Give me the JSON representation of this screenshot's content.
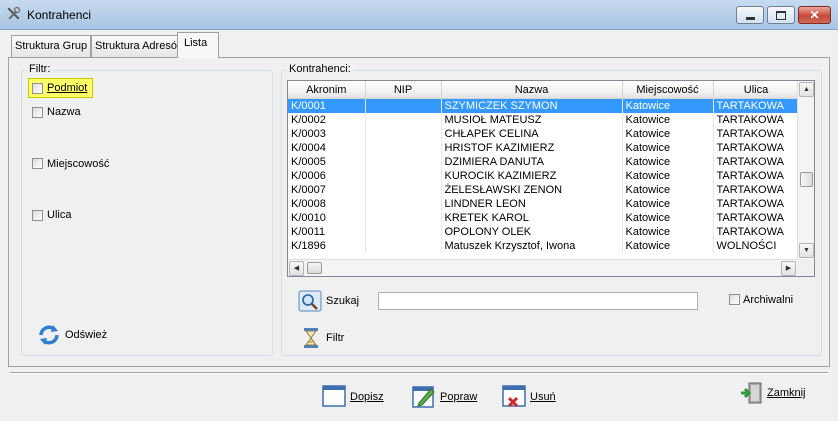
{
  "window": {
    "title": "Kontrahenci"
  },
  "tabs": [
    {
      "label": "Struktura Grup"
    },
    {
      "label": "Struktura Adresów"
    },
    {
      "label": "Lista"
    }
  ],
  "filter": {
    "label": "Filtr:",
    "options": [
      {
        "label": "Podmiot",
        "checked": false,
        "highlighted": true
      },
      {
        "label": "Nazwa",
        "checked": false
      },
      {
        "label": "Miejscowość",
        "checked": false
      },
      {
        "label": "Ulica",
        "checked": false
      }
    ],
    "refresh_label": "Odśwież"
  },
  "contractors": {
    "label": "Kontrahenci:",
    "columns": [
      "Akronim",
      "NIP",
      "Nazwa",
      "Miejscowość",
      "Ulica"
    ],
    "rows": [
      {
        "akronim": "K/0001",
        "nip": "",
        "nazwa": "SZYMICZEK SZYMON",
        "miejscowosc": "Katowice",
        "ulica": "TARTAKOWA",
        "selected": true
      },
      {
        "akronim": "K/0002",
        "nip": "",
        "nazwa": "MUSIOŁ MATEUSZ",
        "miejscowosc": "Katowice",
        "ulica": "TARTAKOWA"
      },
      {
        "akronim": "K/0003",
        "nip": "",
        "nazwa": "CHŁAPEK CELINA",
        "miejscowosc": "Katowice",
        "ulica": "TARTAKOWA"
      },
      {
        "akronim": "K/0004",
        "nip": "",
        "nazwa": "HRISTOF KAZIMIERZ",
        "miejscowosc": "Katowice",
        "ulica": "TARTAKOWA"
      },
      {
        "akronim": "K/0005",
        "nip": "",
        "nazwa": "DZIMIERA DANUTA",
        "miejscowosc": "Katowice",
        "ulica": "TARTAKOWA"
      },
      {
        "akronim": "K/0006",
        "nip": "",
        "nazwa": "KUROCIK KAZIMIERZ",
        "miejscowosc": "Katowice",
        "ulica": "TARTAKOWA"
      },
      {
        "akronim": "K/0007",
        "nip": "",
        "nazwa": "ŻELESŁAWSKI ZENON",
        "miejscowosc": "Katowice",
        "ulica": "TARTAKOWA"
      },
      {
        "akronim": "K/0008",
        "nip": "",
        "nazwa": "LINDNER LEON",
        "miejscowosc": "Katowice",
        "ulica": "TARTAKOWA"
      },
      {
        "akronim": "K/0010",
        "nip": "",
        "nazwa": "KRETEK KAROL",
        "miejscowosc": "Katowice",
        "ulica": "TARTAKOWA"
      },
      {
        "akronim": "K/0011",
        "nip": "",
        "nazwa": "OPOLONY  OLEK",
        "miejscowosc": "Katowice",
        "ulica": "TARTAKOWA"
      },
      {
        "akronim": "K/1896",
        "nip": "",
        "nazwa": "Matuszek Krzysztof, Iwona",
        "miejscowosc": "Katowice",
        "ulica": "WOLNOŚCI"
      }
    ]
  },
  "search": {
    "button_label": "Szukaj",
    "value": "",
    "archive_label": "Archiwalni",
    "archive_checked": false
  },
  "filter_button_label": "Filtr",
  "buttons": {
    "add": "Dopisz",
    "edit": "Popraw",
    "delete": "Usuń",
    "close": "Zamknij"
  },
  "colors": {
    "selection": "#3399ff",
    "highlight": "#ffff66",
    "titlebar": "#b9d1ea"
  },
  "icons": [
    "app-tools-icon",
    "minimize-icon",
    "maximize-icon",
    "close-icon",
    "refresh-icon",
    "search-icon",
    "hourglass-icon",
    "add-document-icon",
    "edit-document-icon",
    "delete-document-icon",
    "exit-door-icon"
  ]
}
